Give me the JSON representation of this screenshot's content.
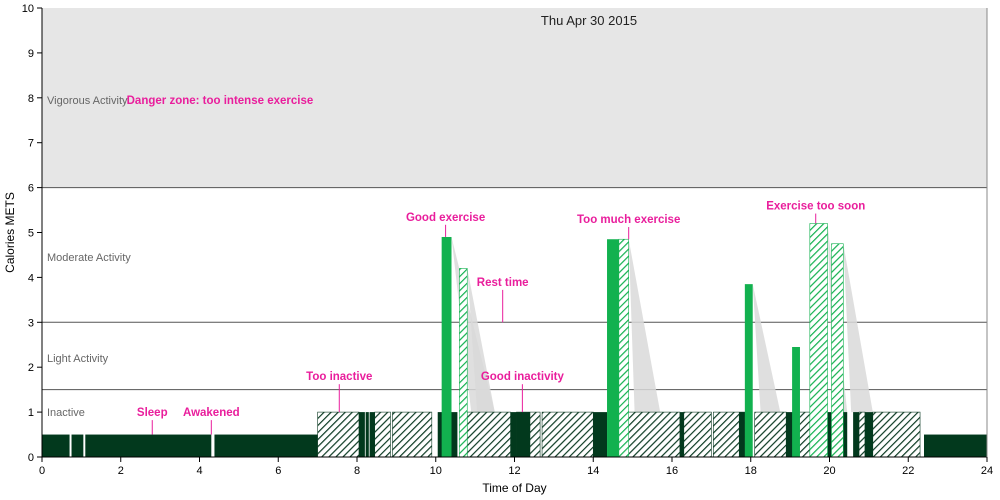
{
  "chart_data": {
    "type": "bar",
    "title": "Thu Apr 30 2015",
    "xlabel": "Time of Day",
    "ylabel": "Calories METS",
    "xlim": [
      0,
      24
    ],
    "ylim": [
      0,
      10
    ],
    "x_ticks": [
      0,
      2,
      4,
      6,
      8,
      10,
      12,
      14,
      16,
      18,
      20,
      22,
      24
    ],
    "y_ticks": [
      0,
      1,
      2,
      3,
      4,
      5,
      6,
      7,
      8,
      9,
      10
    ],
    "zones": [
      {
        "name": "Inactive",
        "label_y": 1.0
      },
      {
        "name": "Light Activity",
        "label_y": 2.2,
        "upper_line": 1.5
      },
      {
        "name": "Moderate Activity",
        "label_y": 4.45,
        "upper_line": 3.0
      },
      {
        "name": "Vigorous Activity",
        "label_y": 7.95,
        "lower_bound": 6.0,
        "upper_bound": 10.0
      }
    ],
    "colors": {
      "vigorous_band": "#e6e6e6",
      "sleep": "#02391d",
      "exercise": "#12b14f",
      "rest_hatch": "#12b14f",
      "inactive_hatch": "#0d3b24",
      "annotation": "#e91e9c",
      "shadow": "#d9d9d9"
    },
    "sleep_segments": [
      {
        "start": 0.0,
        "end": 0.7
      },
      {
        "start": 0.75,
        "end": 1.05
      },
      {
        "start": 1.1,
        "end": 4.3
      },
      {
        "start": 4.38,
        "end": 7.0
      },
      {
        "start": 22.4,
        "end": 24.0
      }
    ],
    "inactive_hatched": [
      {
        "start": 7.0,
        "end": 8.05
      },
      {
        "start": 8.45,
        "end": 8.85
      },
      {
        "start": 8.9,
        "end": 9.9
      },
      {
        "start": 10.8,
        "end": 11.9
      },
      {
        "start": 12.05,
        "end": 12.65
      },
      {
        "start": 12.7,
        "end": 14.0
      },
      {
        "start": 14.85,
        "end": 16.2
      },
      {
        "start": 16.3,
        "end": 17.0
      },
      {
        "start": 17.05,
        "end": 17.85
      },
      {
        "start": 18.1,
        "end": 18.9
      },
      {
        "start": 19.1,
        "end": 19.5
      },
      {
        "start": 20.75,
        "end": 20.9
      },
      {
        "start": 21.1,
        "end": 22.3
      }
    ],
    "inactive_solid": [
      {
        "start": 8.05,
        "end": 8.2
      },
      {
        "start": 8.22,
        "end": 8.3
      },
      {
        "start": 8.32,
        "end": 8.45
      },
      {
        "start": 10.05,
        "end": 10.2
      },
      {
        "start": 10.35,
        "end": 10.55
      },
      {
        "start": 10.65,
        "end": 10.8
      },
      {
        "start": 11.9,
        "end": 12.05
      },
      {
        "start": 12.05,
        "end": 12.4
      },
      {
        "start": 14.0,
        "end": 14.35
      },
      {
        "start": 16.2,
        "end": 16.3
      },
      {
        "start": 17.7,
        "end": 17.85
      },
      {
        "start": 18.9,
        "end": 19.1
      },
      {
        "start": 19.6,
        "end": 19.7
      },
      {
        "start": 20.3,
        "end": 20.45
      },
      {
        "start": 20.6,
        "end": 20.75
      },
      {
        "start": 20.9,
        "end": 21.1
      },
      {
        "start": 19.95,
        "end": 20.05
      }
    ],
    "exercise_bars": [
      {
        "start": 10.15,
        "end": 10.4,
        "value": 4.9
      },
      {
        "start": 14.35,
        "end": 14.65,
        "value": 4.85
      },
      {
        "start": 17.85,
        "end": 18.05,
        "value": 3.85
      },
      {
        "start": 19.05,
        "end": 19.25,
        "value": 2.45
      }
    ],
    "rest_bars": [
      {
        "start": 10.6,
        "end": 10.8,
        "value": 4.2
      },
      {
        "start": 14.65,
        "end": 14.9,
        "value": 4.85
      },
      {
        "start": 19.5,
        "end": 19.95,
        "value": 5.2
      },
      {
        "start": 20.05,
        "end": 20.35,
        "value": 4.75
      }
    ],
    "shadows": [
      {
        "x0": 10.4,
        "y0": 4.9,
        "x1": 11.5,
        "x2": 10.9
      },
      {
        "x0": 10.8,
        "y0": 4.2,
        "x1": 11.5,
        "x2": 11.05
      },
      {
        "x0": 14.9,
        "y0": 4.85,
        "x1": 15.7,
        "x2": 15.05
      },
      {
        "x0": 18.05,
        "y0": 3.85,
        "x1": 18.75,
        "x2": 18.25
      },
      {
        "x0": 19.95,
        "y0": 5.2,
        "x1": 20.45,
        "x2": 20.1
      },
      {
        "x0": 20.35,
        "y0": 4.75,
        "x1": 21.1,
        "x2": 20.55
      }
    ],
    "annotations": [
      {
        "text": "Danger zone: too intense exercise",
        "x": 2.2,
        "y": 7.95,
        "leader": false
      },
      {
        "text": "Sleep",
        "x": 2.8,
        "y": 1.0,
        "leader_to": 0.5
      },
      {
        "text": "Awakened",
        "x": 4.3,
        "y": 1.0,
        "leader_to": 0.5
      },
      {
        "text": "Too inactive",
        "x": 7.55,
        "y": 1.8,
        "leader_to": 1.0
      },
      {
        "text": "Good exercise",
        "x": 10.25,
        "y": 5.35,
        "leader_to": 4.9
      },
      {
        "text": "Rest time",
        "x": 11.7,
        "y": 3.9,
        "leader_to": 3.0
      },
      {
        "text": "Good inactivity",
        "x": 12.2,
        "y": 1.8,
        "leader_to": 1.0
      },
      {
        "text": "Too much exercise",
        "x": 14.9,
        "y": 5.3,
        "leader_to": 4.85
      },
      {
        "text": "Exercise too soon",
        "x": 19.65,
        "y": 5.6,
        "leader_to": 5.2
      }
    ]
  }
}
